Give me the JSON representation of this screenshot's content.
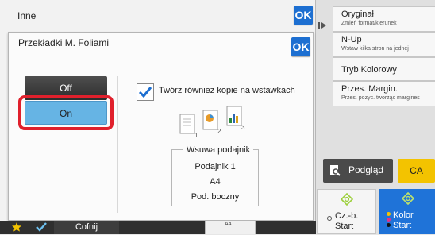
{
  "outer": {
    "title": "Inne",
    "ok_label": "OK"
  },
  "inner": {
    "title": "Przekładki M. Foliami",
    "ok_label": "OK",
    "off_label": "Off",
    "on_label": "On",
    "checkbox_label": "Twórz również kopie na wstawkach",
    "checkbox_checked": true,
    "icon_pages": [
      "1",
      "2",
      "3"
    ],
    "tray": {
      "title": "Wsuwa podajnik",
      "lines": [
        "Podajnik 1",
        "A4",
        "Pod. boczny"
      ]
    }
  },
  "right_menu": [
    {
      "label": "Oryginał",
      "sub": "Zmień format/kierunek"
    },
    {
      "label": "N-Up",
      "sub": "Wstaw kilka stron na jednej"
    },
    {
      "label": "Tryb Kolorowy",
      "sub": ""
    },
    {
      "label": "Przes. Margin.",
      "sub": "Przes. pozyc. tworząc margines"
    }
  ],
  "actions": {
    "preview_label": "Podgląd",
    "ca_label": "CA",
    "bw_start": [
      "Cz.-b.",
      "Start"
    ],
    "color_start": [
      "Kolor",
      "Start"
    ]
  },
  "bottom": {
    "back_label": "Cofnij",
    "paper_label": "A4"
  },
  "colors": {
    "accent_blue": "#1d6fd1",
    "selected_blue": "#66b4e4",
    "highlight_red": "#e0202c",
    "ca_yellow": "#f3c300",
    "color_start_blue": "#1f73d8"
  }
}
